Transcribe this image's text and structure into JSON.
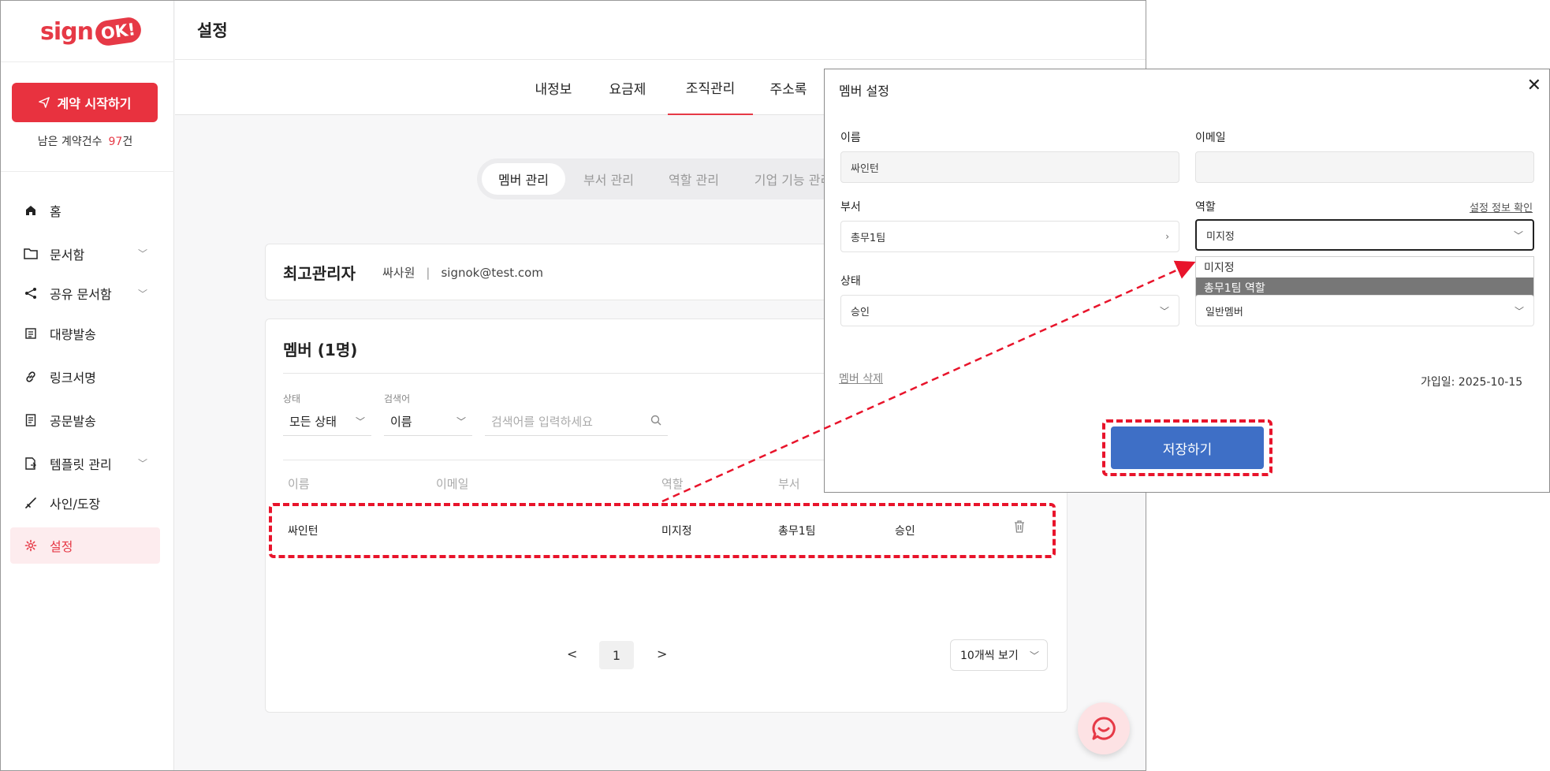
{
  "sidebar": {
    "logo_text": "sign",
    "logo_badge": "OK!",
    "start_button": "계약 시작하기",
    "remain_label": "남은 계약건수",
    "remain_count": "97",
    "remain_unit": "건",
    "items": [
      {
        "label": "홈",
        "icon": "home-icon"
      },
      {
        "label": "문서함",
        "icon": "folder-icon"
      },
      {
        "label": "공유 문서함",
        "icon": "share-icon"
      },
      {
        "label": "대량발송",
        "icon": "bulk-send-icon"
      },
      {
        "label": "링크서명",
        "icon": "link-icon"
      },
      {
        "label": "공문발송",
        "icon": "document-icon"
      },
      {
        "label": "템플릿 관리",
        "icon": "template-icon"
      },
      {
        "label": "사인/도장",
        "icon": "signature-icon"
      },
      {
        "label": "설정",
        "icon": "gear-icon"
      }
    ]
  },
  "header": {
    "title": "설정"
  },
  "tabs": [
    "내정보",
    "요금제",
    "조직관리",
    "주소록"
  ],
  "active_tab": "조직관리",
  "segments": [
    "멤버 관리",
    "부서 관리",
    "역할 관리",
    "기업 기능 관리"
  ],
  "admin": {
    "title": "최고관리자",
    "name": "싸사원",
    "separator": "|",
    "email": "signok@test.com"
  },
  "members": {
    "title": "멤버 (1명)",
    "filter_status_label": "상태",
    "filter_status_value": "모든 상태",
    "filter_search_label": "검색어",
    "filter_search_value": "이름",
    "search_placeholder": "검색어를 입력하세요",
    "columns": [
      "이름",
      "이메일",
      "역할",
      "부서"
    ],
    "row": {
      "name": "싸인턴",
      "role": "미지정",
      "dept": "총무1팀",
      "status": "승인"
    },
    "page": "1",
    "prev": "<",
    "next": ">",
    "per_page": "10개씩 보기"
  },
  "modal": {
    "title": "멤버 설정",
    "name_label": "이름",
    "name_value": "싸인턴",
    "email_label": "이메일",
    "email_value": "",
    "dept_label": "부서",
    "dept_value": "총무1팀",
    "role_label": "역할",
    "role_link": "설정 정보 확인",
    "role_value": "미지정",
    "role_options": [
      "미지정",
      "총무1팀 역할"
    ],
    "status_label": "상태",
    "status_value": "승인",
    "type_value": "일반멤버",
    "delete_link": "멤버 삭제",
    "joined": "가입일: 2025-10-15",
    "save_button": "저장하기"
  },
  "colors": {
    "brand": "#e63946",
    "save": "#3e6fc6",
    "highlight": "#e8142b"
  }
}
